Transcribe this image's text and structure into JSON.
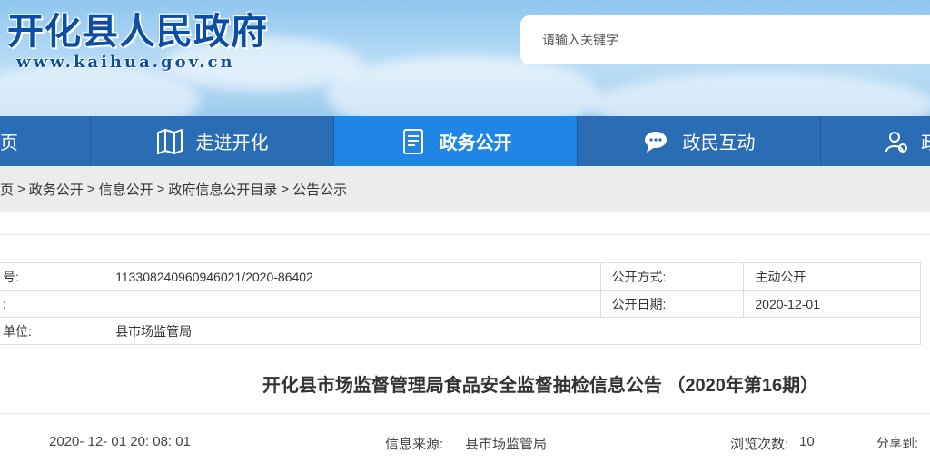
{
  "header": {
    "site_title": "开化县人民政府",
    "site_url": "www.kaihua.gov.cn",
    "search_placeholder": "请输入关键字"
  },
  "nav": {
    "items": [
      {
        "label": "页",
        "icon": "home-icon"
      },
      {
        "label": "走进开化",
        "icon": "map-icon"
      },
      {
        "label": "政务公开",
        "icon": "document-icon",
        "active": true
      },
      {
        "label": "政民互动",
        "icon": "chat-icon"
      },
      {
        "label": "政",
        "icon": "user-service-icon"
      }
    ]
  },
  "breadcrumb": {
    "items": [
      "页",
      "政务公开",
      "信息公开",
      "政府信息公开目录",
      "公告公示"
    ],
    "separator": ">"
  },
  "info": {
    "row1": {
      "label": "号:",
      "value": "113308240960946021/2020-86402",
      "label2": "公开方式:",
      "value2": "主动公开"
    },
    "row2": {
      "label": ":",
      "value": "",
      "label2": "公开日期:",
      "value2": "2020-12-01"
    },
    "row3": {
      "label": "单位:",
      "value": "县市场监管局"
    }
  },
  "article": {
    "title": "开化县市场监督管理局食品安全监督抽检信息公告 （2020年第16期）",
    "datetime": "2020- 12- 01 20: 08: 01",
    "source_label": "信息来源:",
    "source": "县市场监管局",
    "views_label": "浏览次数:",
    "views": "10",
    "share_label": "分享到:"
  },
  "colors": {
    "nav_bg": "#2a6db5",
    "nav_active": "#1f86e6",
    "title_blue": "#0b4ea6"
  }
}
